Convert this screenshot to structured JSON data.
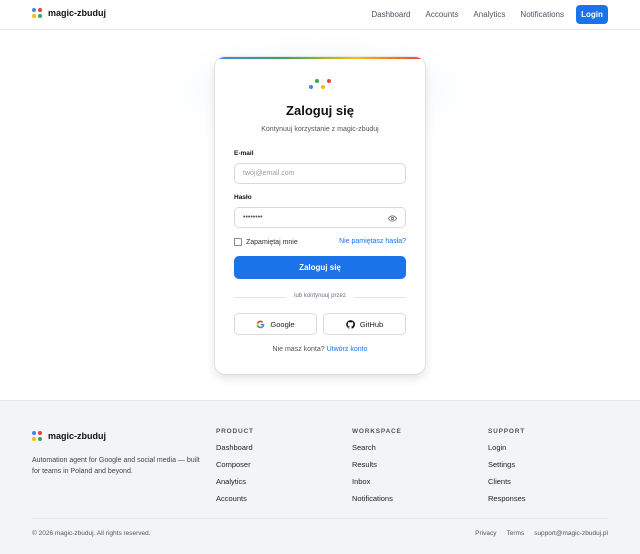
{
  "colors": {
    "accent": "#1a73e8",
    "logo": [
      "#4285f4",
      "#ea4335",
      "#fbbc05",
      "#34a853"
    ]
  },
  "header": {
    "brand": "magic-zbuduj",
    "nav": [
      "Dashboard",
      "Accounts",
      "Analytics",
      "Notifications"
    ],
    "login_label": "Login"
  },
  "card": {
    "title": "Zaloguj się",
    "subtitle": "Kontynuuj korzystanie z magic-zbuduj",
    "email_label": "E-mail",
    "email_placeholder": "twój@email.com",
    "password_label": "Hasło",
    "password_value": "••••••••",
    "remember_label": "Zapamiętaj mnie",
    "forgot_label": "Nie pamiętasz hasła?",
    "submit_label": "Zaloguj się",
    "divider_text": "lub kontynuuj przez",
    "google_label": "Google",
    "github_label": "GitHub",
    "signup_text": "Nie masz konta?",
    "signup_link": "Utwórz konto"
  },
  "footer": {
    "brand": "magic-zbuduj",
    "description": "Automation agent for Google and social media — built for teams in Poland and beyond.",
    "columns": [
      {
        "title": "PRODUCT",
        "links": [
          "Dashboard",
          "Composer",
          "Analytics",
          "Accounts"
        ]
      },
      {
        "title": "WORKSPACE",
        "links": [
          "Search",
          "Results",
          "Inbox",
          "Notifications"
        ]
      },
      {
        "title": "SUPPORT",
        "links": [
          "Login",
          "Settings",
          "Clients",
          "Responses"
        ]
      }
    ],
    "copyright": "© 2026 magic-zbuduj. All rights reserved.",
    "legal": [
      "Privacy",
      "Terms",
      "support@magic-zbuduj.pl"
    ]
  }
}
